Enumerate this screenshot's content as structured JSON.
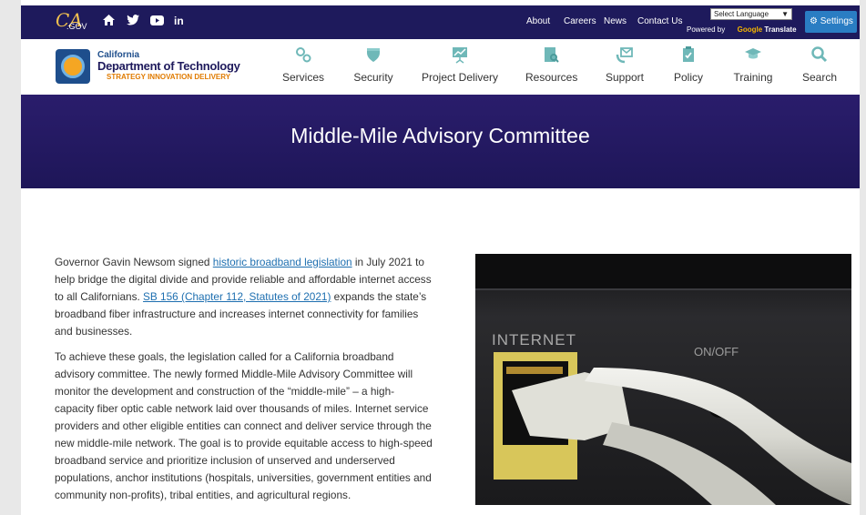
{
  "utility_bar": {
    "logo_ca": "CA",
    "logo_gov": ".GOV",
    "social": [
      "home-icon",
      "twitter-icon",
      "youtube-icon",
      "linkedin-icon"
    ],
    "links": [
      "About",
      "Careers",
      "News",
      "Contact Us"
    ],
    "language_select": "Select Language",
    "powered_by": "Powered by",
    "google": "Google",
    "translate": "Translate",
    "settings_label": "Settings"
  },
  "header": {
    "logo_line1": "California",
    "logo_line2": "Department of Technology",
    "tagline_strategy": "STRATEGY",
    "tagline_innovation": "INNOVATION",
    "tagline_delivery": "DELIVERY"
  },
  "nav": {
    "items": [
      {
        "label": "Services",
        "icon": "gears-icon"
      },
      {
        "label": "Security",
        "icon": "shield-icon"
      },
      {
        "label": "Project Delivery",
        "icon": "presentation-icon"
      },
      {
        "label": "Resources",
        "icon": "document-search-icon"
      },
      {
        "label": "Support",
        "icon": "support-mail-icon"
      },
      {
        "label": "Policy",
        "icon": "clipboard-check-icon"
      },
      {
        "label": "Training",
        "icon": "graduation-cap-icon"
      },
      {
        "label": "Search",
        "icon": "search-icon"
      }
    ]
  },
  "banner": {
    "title": "Middle-Mile Advisory Committee"
  },
  "content": {
    "p1_part1": "Governor Gavin Newsom signed ",
    "p1_link1": "historic broadband legislation",
    "p1_part2": " in July 2021 to help bridge the digital divide and provide reliable and affordable internet access to all Californians. ",
    "p1_link2": "SB 156 (Chapter 112, Statutes of 2021)",
    "p1_part3": " expands the state’s broadband fiber infrastructure and increases internet connectivity for families and businesses.",
    "p2": "To achieve these goals, the legislation called for a California broadband advisory committee. The newly formed Middle-Mile Advisory Committee will monitor the development and construction of the “middle-mile” – a high-capacity fiber optic cable network laid over thousands of miles. Internet service providers and other eligible entities can connect and deliver service through the new middle-mile network. The goal is to provide equitable access to high-speed broadband service and prioritize inclusion of unserved and underserved populations, anchor institutions (hospitals, universities, government entities and community non-profits), tribal entities, and agricultural regions."
  },
  "photo": {
    "port_label": "INTERNET",
    "switch_label": "ON/OFF"
  },
  "colors": {
    "utility_bg": "#1e1a5c",
    "banner_bg": "#231a63",
    "accent_blue": "#2a7dc3",
    "link": "#1e6fb0",
    "icon_teal": "#6fb8b8"
  }
}
